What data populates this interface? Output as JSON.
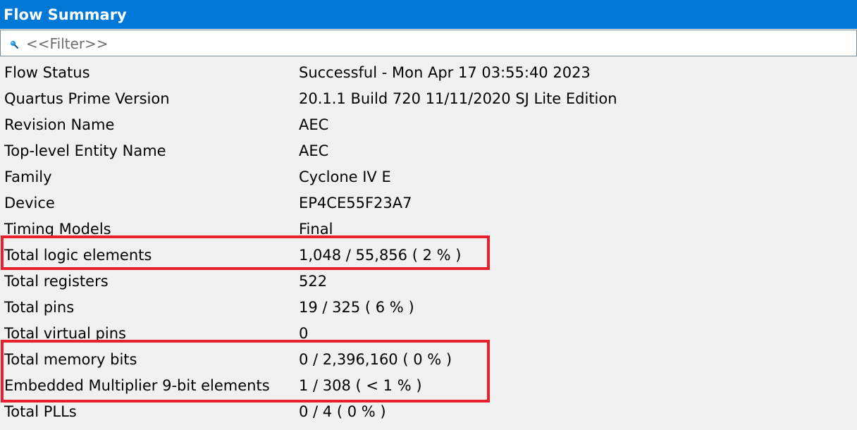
{
  "panel": {
    "title": "Flow Summary"
  },
  "filter": {
    "placeholder": "<<Filter>>",
    "value": ""
  },
  "icons": {
    "search": "search-icon"
  },
  "colors": {
    "title_bar": "#0078d7",
    "highlight_box": "#e8202b"
  },
  "rows": [
    {
      "label": "Flow Status",
      "value": "Successful - Mon Apr 17 03:55:40 2023"
    },
    {
      "label": "Quartus Prime Version",
      "value": "20.1.1 Build 720 11/11/2020 SJ Lite Edition"
    },
    {
      "label": "Revision Name",
      "value": "AEC"
    },
    {
      "label": "Top-level Entity Name",
      "value": "AEC"
    },
    {
      "label": "Family",
      "value": "Cyclone IV E"
    },
    {
      "label": "Device",
      "value": "EP4CE55F23A7"
    },
    {
      "label": "Timing Models",
      "value": "Final"
    },
    {
      "label": "Total logic elements",
      "value": "1,048 / 55,856 ( 2 % )"
    },
    {
      "label": "Total registers",
      "value": "522"
    },
    {
      "label": "Total pins",
      "value": "19 / 325 ( 6 % )"
    },
    {
      "label": "Total virtual pins",
      "value": "0"
    },
    {
      "label": "Total memory bits",
      "value": "0 / 2,396,160 ( 0 % )"
    },
    {
      "label": "Embedded Multiplier 9-bit elements",
      "value": "1 / 308 ( < 1 % )"
    },
    {
      "label": "Total PLLs",
      "value": "0 / 4 ( 0 % )"
    }
  ]
}
